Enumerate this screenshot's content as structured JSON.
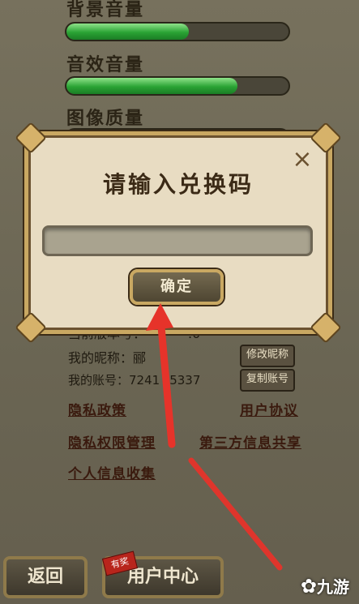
{
  "settings": {
    "bgm_label": "背景音量",
    "bgm_level": 0.55,
    "sfx_label": "音效音量",
    "sfx_level": 0.77,
    "gfx_label": "图像质量"
  },
  "account": {
    "version_label": "当前版本号：",
    "version_value": ".0",
    "nickname_label": "我的昵称：",
    "nickname_value": "郦",
    "edit_nickname_btn": "修改昵称",
    "account_label": "我的账号：",
    "account_value": "7241",
    "account_value_tail": "5337",
    "copy_account_btn": "复制账号"
  },
  "links": {
    "privacy_policy": "隐私政策",
    "user_agreement": "用户协议",
    "privacy_permissions": "隐私权限管理",
    "third_party_sharing": "第三方信息共享",
    "personal_info": "个人信息收集"
  },
  "dialog": {
    "title": "请输入兑换码",
    "close_icon": "×",
    "input_value": "",
    "input_placeholder": "",
    "confirm_label": "确定"
  },
  "bottom": {
    "back_label": "返回",
    "user_center_label": "用户中心",
    "badge": "有奖"
  },
  "watermark": {
    "text": "九游"
  },
  "colors": {
    "annotation_arrow": "#e6332a",
    "progress_fill": "#2aa334",
    "dialog_frame": "#c9a862"
  }
}
